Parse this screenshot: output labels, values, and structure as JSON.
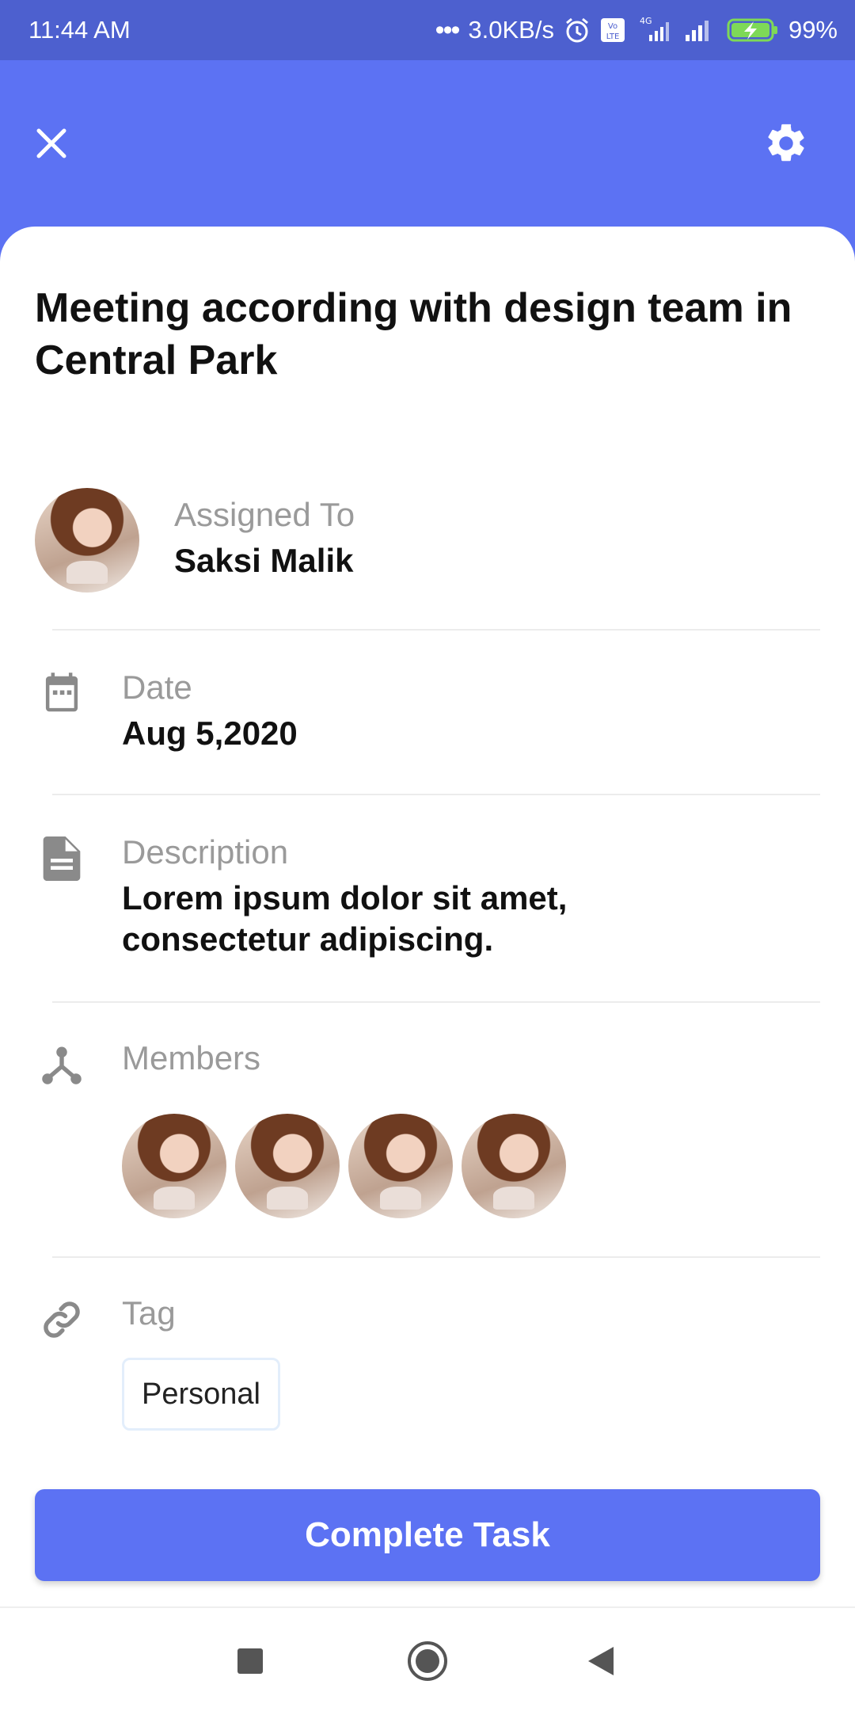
{
  "status_bar": {
    "time": "11:44 AM",
    "network_speed": "3.0KB/s",
    "battery": "99%",
    "icons": [
      "dots-icon",
      "alarm-icon",
      "volte-icon",
      "signal-4g-icon",
      "signal-icon",
      "battery-charging-icon"
    ]
  },
  "header": {
    "close_icon": "close-icon",
    "settings_icon": "gear-icon"
  },
  "task": {
    "title": "Meeting according with design team in Central Park",
    "assigned": {
      "label": "Assigned To",
      "value": "Saksi Malik"
    },
    "date": {
      "label": "Date",
      "value": "Aug 5,2020",
      "icon": "calendar-icon"
    },
    "description": {
      "label": "Description",
      "value_line1": "Lorem ipsum dolor sit amet,",
      "value_line2": "consectetur adipiscing.",
      "icon": "document-icon"
    },
    "members": {
      "label": "Members",
      "count": 4,
      "icon": "members-icon"
    },
    "tag": {
      "label": "Tag",
      "value": "Personal",
      "icon": "link-icon"
    }
  },
  "actions": {
    "complete_label": "Complete Task"
  },
  "nav": {
    "items": [
      "recent-apps-icon",
      "home-icon",
      "back-icon"
    ]
  },
  "colors": {
    "primary": "#5C72F3",
    "status_bar": "#4D60CF",
    "battery_green": "#7ED957"
  }
}
